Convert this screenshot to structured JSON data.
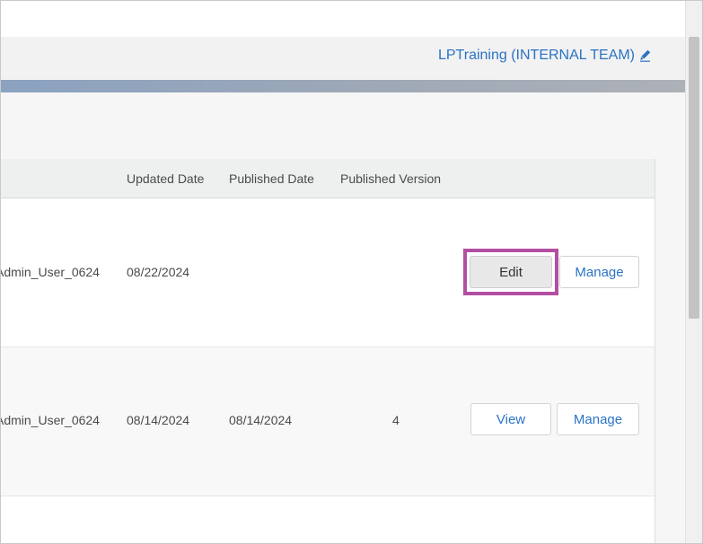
{
  "header": {
    "org_name": "LPTraining (INTERNAL TEAM)",
    "edit_icon": "pencil-icon"
  },
  "table": {
    "columns": [
      "Updated Date",
      "Published Date",
      "Published Version"
    ],
    "rows": [
      {
        "updated_by": "Admin_User_0624",
        "updated_date": "08/22/2024",
        "published_date": "",
        "published_version": "",
        "primary_action": "Edit",
        "secondary_action": "Manage"
      },
      {
        "updated_by": "Admin_User_0624",
        "updated_date": "08/14/2024",
        "published_date": "08/14/2024",
        "published_version": "4",
        "primary_action": "View",
        "secondary_action": "Manage"
      }
    ]
  },
  "colors": {
    "link": "#2b73c4",
    "highlight": "#b24fa3"
  }
}
